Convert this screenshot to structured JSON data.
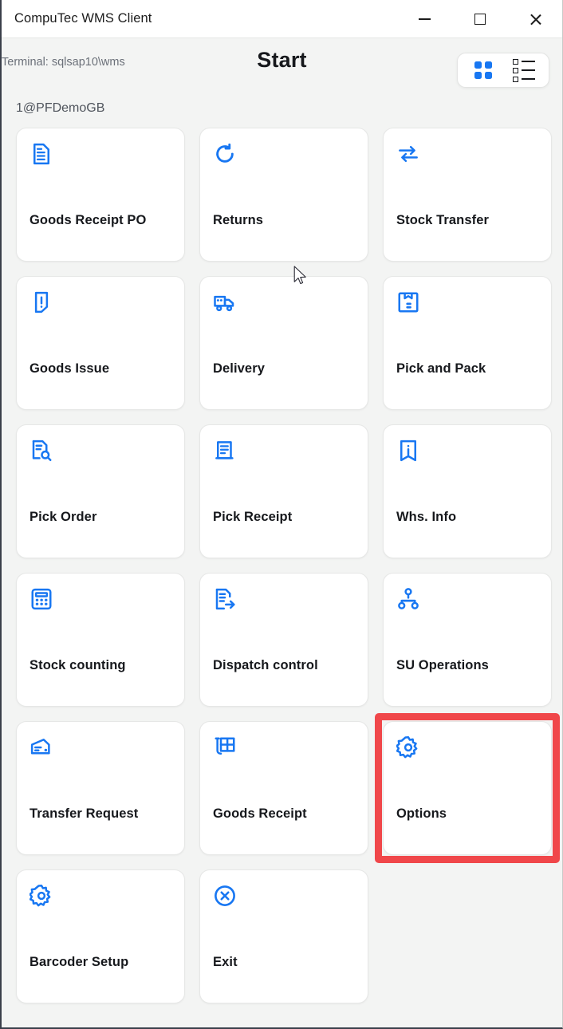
{
  "window": {
    "title": "CompuTec WMS Client",
    "controls": {
      "minimize": "minimize-button",
      "maximize": "maximize-button",
      "close": "close-button"
    }
  },
  "header": {
    "terminal": "Terminal: sqlsap10\\wms",
    "title": "Start",
    "view_toggle": {
      "grid_label": "grid-view",
      "list_label": "list-view",
      "active": "grid"
    }
  },
  "subheader": {
    "connection": "1@PFDemoGB"
  },
  "colors": {
    "accent": "#1877f2",
    "highlight": "#f0474a",
    "tile_bg": "#ffffff",
    "page_bg": "#f3f4f3",
    "text": "#16181c",
    "muted": "#6b7079"
  },
  "tiles": [
    {
      "label": "Goods Receipt PO",
      "icon": "document-lines-icon",
      "highlighted": false
    },
    {
      "label": "Returns",
      "icon": "refresh-circular-arrow-icon",
      "highlighted": false
    },
    {
      "label": "Stock Transfer",
      "icon": "two-way-arrows-icon",
      "highlighted": false
    },
    {
      "label": "Goods Issue",
      "icon": "document-exclamation-icon",
      "highlighted": false
    },
    {
      "label": "Delivery",
      "icon": "delivery-truck-icon",
      "highlighted": false
    },
    {
      "label": "Pick and Pack",
      "icon": "package-box-icon",
      "highlighted": false
    },
    {
      "label": "Pick Order",
      "icon": "document-magnifier-icon",
      "highlighted": false
    },
    {
      "label": "Pick Receipt",
      "icon": "document-receipt-icon",
      "highlighted": false
    },
    {
      "label": "Whs. Info",
      "icon": "info-bookmark-icon",
      "highlighted": false
    },
    {
      "label": "Stock counting",
      "icon": "calculator-icon",
      "highlighted": false
    },
    {
      "label": "Dispatch control",
      "icon": "document-arrow-out-icon",
      "highlighted": false
    },
    {
      "label": "SU Operations",
      "icon": "hierarchy-nodes-icon",
      "highlighted": false
    },
    {
      "label": "Transfer Request",
      "icon": "card-envelope-icon",
      "highlighted": false
    },
    {
      "label": "Goods Receipt",
      "icon": "shelf-rack-icon",
      "highlighted": false
    },
    {
      "label": "Options",
      "icon": "gear-icon",
      "highlighted": true
    },
    {
      "label": "Barcoder Setup",
      "icon": "gear-icon",
      "highlighted": false
    },
    {
      "label": "Exit",
      "icon": "circle-x-icon",
      "highlighted": false
    }
  ]
}
